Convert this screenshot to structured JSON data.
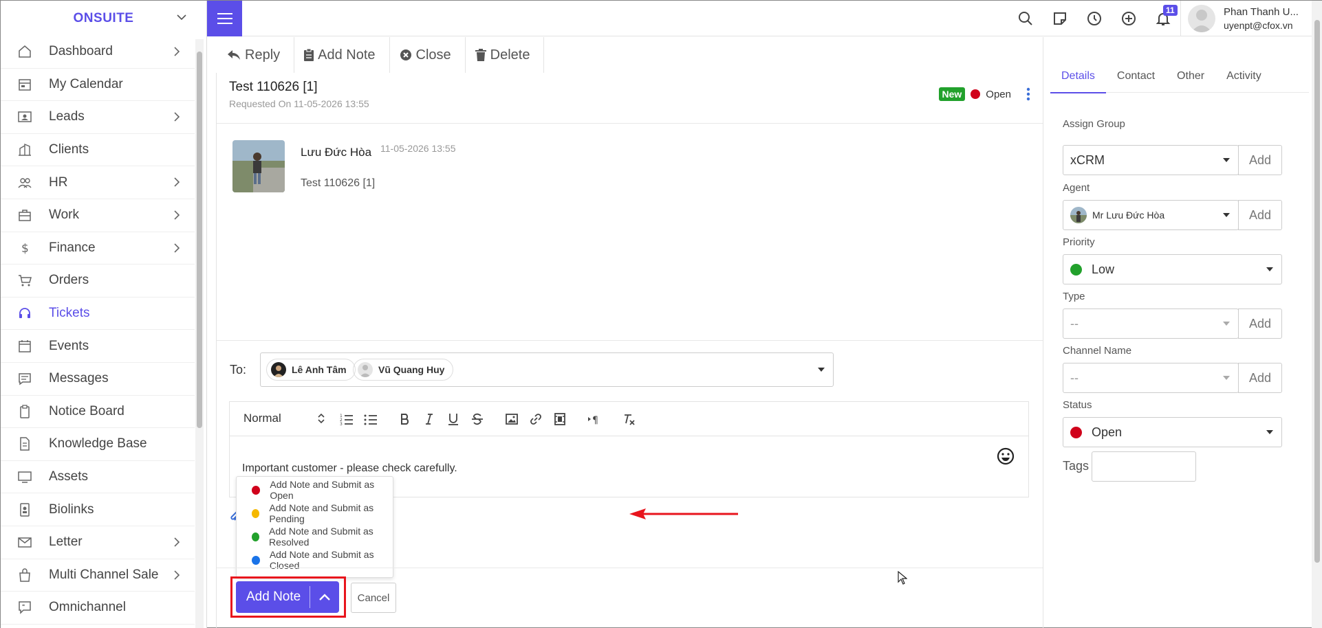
{
  "sidebar": {
    "logo": "ONSUITE",
    "items": [
      {
        "label": "Dashboard",
        "icon": "home-icon"
      },
      {
        "label": "My Calendar",
        "icon": "calendar-icon"
      },
      {
        "label": "Leads",
        "icon": "contact-card-icon"
      },
      {
        "label": "Clients",
        "icon": "building-icon"
      },
      {
        "label": "HR",
        "icon": "users-icon"
      },
      {
        "label": "Work",
        "icon": "briefcase-icon"
      },
      {
        "label": "Finance",
        "icon": "dollar-icon"
      },
      {
        "label": "Orders",
        "icon": "cart-icon"
      },
      {
        "label": "Tickets",
        "icon": "headset-icon"
      },
      {
        "label": "Events",
        "icon": "event-calendar-icon"
      },
      {
        "label": "Messages",
        "icon": "chat-icon"
      },
      {
        "label": "Notice Board",
        "icon": "clipboard-icon"
      },
      {
        "label": "Knowledge Base",
        "icon": "document-icon"
      },
      {
        "label": "Assets",
        "icon": "monitor-icon"
      },
      {
        "label": "Biolinks",
        "icon": "id-badge-icon"
      },
      {
        "label": "Letter",
        "icon": "mail-icon"
      },
      {
        "label": "Multi Channel Sale",
        "icon": "shopping-bag-icon"
      },
      {
        "label": "Omnichannel",
        "icon": "quote-bubble-icon"
      }
    ]
  },
  "topbar": {
    "notification_count": "11",
    "user_name": "Phan Thanh U...",
    "user_email": "uyenpt@cfox.vn"
  },
  "toolbar": {
    "reply": "Reply",
    "add_note": "Add Note",
    "close": "Close",
    "delete": "Delete"
  },
  "ticket": {
    "title": "Test 110626 [1]",
    "requested": "Requested On 11-05-2026 13:55",
    "badge": "New",
    "status": "Open"
  },
  "message": {
    "author": "Lưu Đức Hòa",
    "time": "11-05-2026 13:55",
    "body": "Test 110626 [1]"
  },
  "compose": {
    "to_label": "To:",
    "recipients": [
      "Lê Anh Tâm",
      "Vũ Quang Huy"
    ],
    "format": "Normal",
    "text": "Important customer - please check carefully.",
    "dropdown": [
      {
        "label": "Add Note and Submit as Open",
        "color": "#d0021b"
      },
      {
        "label": "Add Note and Submit as Pending",
        "color": "#f5b800"
      },
      {
        "label": "Add Note and Submit as Resolved",
        "color": "#22a12c"
      },
      {
        "label": "Add Note and Submit as Closed",
        "color": "#1a73e8"
      }
    ],
    "submit": "Add Note",
    "cancel": "Cancel"
  },
  "details": {
    "tabs": [
      "Details",
      "Contact",
      "Other",
      "Activity"
    ],
    "assign_group_label": "Assign Group",
    "assign_group": "xCRM",
    "agent_label": "Agent",
    "agent": "Mr Lưu Đức Hòa",
    "priority_label": "Priority",
    "priority": "Low",
    "type_label": "Type",
    "type": "--",
    "channel_label": "Channel Name",
    "channel": "--",
    "status_label": "Status",
    "status": "Open",
    "tags_label": "Tags",
    "add": "Add"
  }
}
